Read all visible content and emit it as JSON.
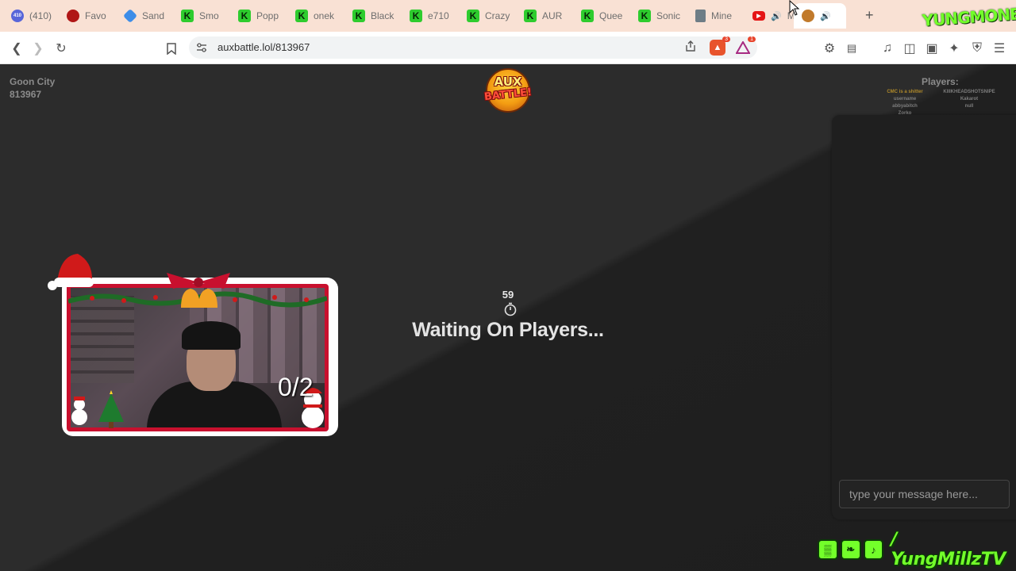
{
  "browser": {
    "tabs": [
      {
        "label": "(410)",
        "favicon": "inbox-410-icon",
        "favicon_text": "410",
        "favicon_class": "circ"
      },
      {
        "label": "Favo",
        "favicon": "red-dot-icon",
        "favicon_text": "",
        "favicon_class": "dot-red"
      },
      {
        "label": "Sand",
        "favicon": "blue-gem-icon",
        "favicon_text": "",
        "favicon_class": "blue"
      },
      {
        "label": "Smo",
        "favicon": "kick-icon",
        "favicon_text": "K",
        "favicon_class": "k"
      },
      {
        "label": "Popp",
        "favicon": "kick-icon",
        "favicon_text": "K",
        "favicon_class": "k"
      },
      {
        "label": "onek",
        "favicon": "kick-icon",
        "favicon_text": "K",
        "favicon_class": "k"
      },
      {
        "label": "Black",
        "favicon": "kick-icon",
        "favicon_text": "K",
        "favicon_class": "k"
      },
      {
        "label": "e710",
        "favicon": "kick-icon",
        "favicon_text": "K",
        "favicon_class": "k"
      },
      {
        "label": "Crazy",
        "favicon": "kick-icon",
        "favicon_text": "K",
        "favicon_class": "k"
      },
      {
        "label": "AUR",
        "favicon": "kick-icon",
        "favicon_text": "K",
        "favicon_class": "k"
      },
      {
        "label": "Quee",
        "favicon": "kick-icon",
        "favicon_text": "K",
        "favicon_class": "k"
      },
      {
        "label": "Sonic",
        "favicon": "kick-icon",
        "favicon_text": "K",
        "favicon_class": "k"
      },
      {
        "label": "Mine",
        "favicon": "doc-icon",
        "favicon_text": "",
        "favicon_class": "doc"
      },
      {
        "label": "M",
        "favicon": "youtube-icon",
        "favicon_text": "▶",
        "favicon_class": "yt",
        "speaker": "🔊"
      },
      {
        "label": "",
        "favicon": "burger-icon",
        "favicon_text": "",
        "favicon_class": "burger",
        "speaker": "🔊",
        "close": "✕",
        "active": true
      }
    ],
    "new_tab": "+",
    "address": {
      "url": "auxbattle.lol/813967"
    },
    "brave_badge": "3",
    "alert_badge": "1"
  },
  "stream": {
    "top_watermark": "YUNGMONEY",
    "bottom_watermark": "/ YungMillzTV"
  },
  "game": {
    "room_name": "Goon City",
    "room_code": "813967",
    "logo_top": "AUX",
    "logo_bottom": "BATTLE!",
    "players_title": "Players:",
    "players_left": [
      "CMC is a shitter",
      "username",
      "abbyabitch",
      "Zorko"
    ],
    "players_right": [
      "KIIIKHEADSHOTSNIPE",
      "Kakarot",
      "null"
    ],
    "timer": "59",
    "status": "Waiting On Players...",
    "chat_placeholder": "type your message here..."
  },
  "webcam": {
    "counter": "0/2"
  },
  "colors": {
    "accent_green": "#73ff2a",
    "frame_red": "#c8102e",
    "highlight_player": "#b08a2a"
  }
}
